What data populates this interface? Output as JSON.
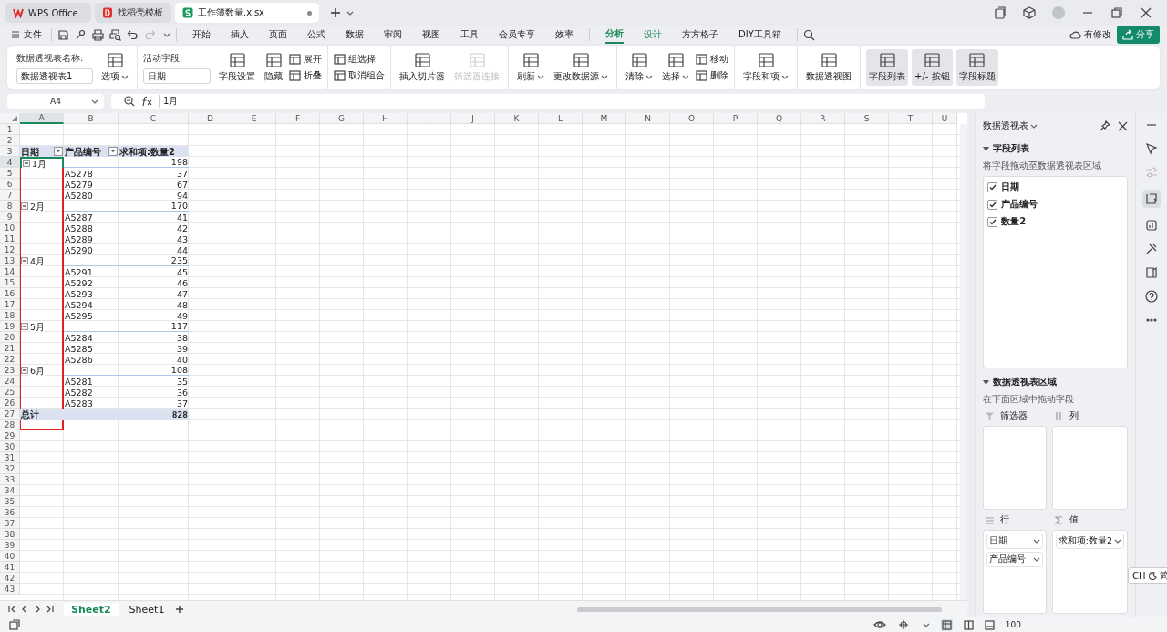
{
  "title_tabs": [
    {
      "label": "WPS Office",
      "kind": "home",
      "selected": false
    },
    {
      "label": "找稻壳模板",
      "kind": "docer",
      "selected": false
    },
    {
      "label": "工作簿数量.xlsx",
      "kind": "sheet",
      "selected": true
    }
  ],
  "menu": {
    "file_label": "文件",
    "tabs": [
      {
        "label": "开始",
        "kind": "standard",
        "selected": false
      },
      {
        "label": "插入",
        "kind": "standard",
        "selected": false
      },
      {
        "label": "页面",
        "kind": "standard",
        "selected": false
      },
      {
        "label": "公式",
        "kind": "standard",
        "selected": false
      },
      {
        "label": "数据",
        "kind": "standard",
        "selected": false
      },
      {
        "label": "审阅",
        "kind": "standard",
        "selected": false
      },
      {
        "label": "视图",
        "kind": "standard",
        "selected": false
      },
      {
        "label": "工具",
        "kind": "standard",
        "selected": false
      },
      {
        "label": "会员专享",
        "kind": "standard",
        "selected": false
      },
      {
        "label": "效率",
        "kind": "standard",
        "selected": false
      },
      {
        "label": "分析",
        "kind": "contextual",
        "selected": true
      },
      {
        "label": "设计",
        "kind": "contextual",
        "selected": false
      },
      {
        "label": "方方格子",
        "kind": "standard",
        "selected": false
      },
      {
        "label": "DIY工具箱",
        "kind": "standard",
        "selected": false
      }
    ],
    "modified_label": "有修改",
    "share_label": "分享"
  },
  "ribbon": [
    {
      "items": [
        {
          "kind": "field",
          "label": "数据透视表名称:",
          "value": "数据透视表1"
        },
        {
          "kind": "big",
          "label": "选项",
          "dropdown": true
        }
      ]
    },
    {
      "items": [
        {
          "kind": "field",
          "label": "活动字段:",
          "value": "日期"
        },
        {
          "kind": "big",
          "label": "字段设置"
        },
        {
          "kind": "big",
          "label": "隐藏"
        },
        {
          "kind": "stack",
          "buttons": [
            {
              "label": "展开"
            },
            {
              "label": "折叠"
            }
          ]
        }
      ]
    },
    {
      "items": [
        {
          "kind": "stack",
          "buttons": [
            {
              "label": "组选择"
            },
            {
              "label": "取消组合"
            }
          ]
        }
      ]
    },
    {
      "items": [
        {
          "kind": "big",
          "label": "插入切片器"
        },
        {
          "kind": "big",
          "label": "筛选器连接",
          "disabled": true
        }
      ]
    },
    {
      "items": [
        {
          "kind": "big",
          "label": "刷新",
          "dropdown": true
        },
        {
          "kind": "big",
          "label": "更改数据源",
          "dropdown": true
        }
      ]
    },
    {
      "items": [
        {
          "kind": "big",
          "label": "清除",
          "dropdown": true
        },
        {
          "kind": "big",
          "label": "选择",
          "dropdown": true
        },
        {
          "kind": "stack",
          "buttons": [
            {
              "label": "移动"
            },
            {
              "label": "删除"
            }
          ]
        }
      ]
    },
    {
      "items": [
        {
          "kind": "big",
          "label": "字段和项",
          "dropdown": true
        }
      ]
    },
    {
      "items": [
        {
          "kind": "big",
          "label": "数据透视图"
        }
      ]
    },
    {
      "items": [
        {
          "kind": "big",
          "label": "字段列表",
          "selected": true
        },
        {
          "kind": "big",
          "label": "+/- 按钮",
          "selected": true
        },
        {
          "kind": "big",
          "label": "字段标题",
          "selected": true
        }
      ]
    }
  ],
  "formula_bar": {
    "name_box": "A4",
    "value": "1月"
  },
  "sheet": {
    "columns": [
      "A",
      "B",
      "C",
      "D",
      "E",
      "F",
      "G",
      "H",
      "I",
      "J",
      "K",
      "L",
      "M",
      "N",
      "O",
      "P",
      "Q",
      "R",
      "S",
      "T",
      "U"
    ],
    "row_numbers": [
      "1",
      "2",
      "3",
      "4",
      "5",
      "6",
      "7",
      "8",
      "9",
      "10",
      "11",
      "12",
      "13",
      "14",
      "15",
      "16",
      "17",
      "18",
      "19",
      "20",
      "21",
      "22",
      "23",
      "24",
      "25",
      "26",
      "27",
      "28",
      "29",
      "30",
      "31",
      "32",
      "33",
      "34",
      "35",
      "36",
      "37",
      "38",
      "39",
      "40",
      "41",
      "42",
      "43"
    ],
    "pivot": {
      "headers": [
        "日期",
        "产品编号",
        "求和项:数量2"
      ],
      "groups": [
        {
          "label": "1月",
          "total": "198",
          "expanded": true,
          "selected": true,
          "items": [
            {
              "code": "A5278",
              "value": "37"
            },
            {
              "code": "A5279",
              "value": "67"
            },
            {
              "code": "A5280",
              "value": "94"
            }
          ]
        },
        {
          "label": "2月",
          "total": "170",
          "expanded": true,
          "selected": false,
          "items": [
            {
              "code": "A5287",
              "value": "41"
            },
            {
              "code": "A5288",
              "value": "42"
            },
            {
              "code": "A5289",
              "value": "43"
            },
            {
              "code": "A5290",
              "value": "44"
            }
          ]
        },
        {
          "label": "4月",
          "total": "235",
          "expanded": true,
          "selected": false,
          "items": [
            {
              "code": "A5291",
              "value": "45"
            },
            {
              "code": "A5292",
              "value": "46"
            },
            {
              "code": "A5293",
              "value": "47"
            },
            {
              "code": "A5294",
              "value": "48"
            },
            {
              "code": "A5295",
              "value": "49"
            }
          ]
        },
        {
          "label": "5月",
          "total": "117",
          "expanded": true,
          "selected": false,
          "items": [
            {
              "code": "A5284",
              "value": "38"
            },
            {
              "code": "A5285",
              "value": "39"
            },
            {
              "code": "A5286",
              "value": "40"
            }
          ]
        },
        {
          "label": "6月",
          "total": "108",
          "expanded": true,
          "selected": false,
          "items": [
            {
              "code": "A5281",
              "value": "35"
            },
            {
              "code": "A5282",
              "value": "36"
            },
            {
              "code": "A5283",
              "value": "37"
            }
          ]
        }
      ],
      "grand_total": {
        "label": "总计",
        "value": "828"
      }
    },
    "highlight_frame": true
  },
  "sheet_tabs": [
    {
      "label": "Sheet2",
      "selected": true
    },
    {
      "label": "Sheet1",
      "selected": false
    }
  ],
  "panel": {
    "title": "数据透视表",
    "field_section": {
      "title": "字段列表",
      "expanded": true,
      "hint": "将字段拖动至数据透视表区域",
      "fields": [
        {
          "label": "日期",
          "checked": true
        },
        {
          "label": "产品编号",
          "checked": true
        },
        {
          "label": "数量2",
          "checked": true
        }
      ]
    },
    "area_section": {
      "title": "数据透视表区域",
      "expanded": true,
      "hint": "在下面区域中拖动字段",
      "areas": [
        {
          "kind": "filter",
          "label": "筛选器"
        },
        {
          "kind": "columns",
          "label": "列"
        },
        {
          "kind": "rows",
          "label": "行",
          "items": [
            "日期",
            "产品编号"
          ]
        },
        {
          "kind": "values",
          "label": "值",
          "items": [
            "求和项:数量2"
          ]
        }
      ]
    }
  },
  "ime_indicator": {
    "mode": "CH",
    "script": "简"
  },
  "status_bar": {
    "zoom": "100"
  }
}
